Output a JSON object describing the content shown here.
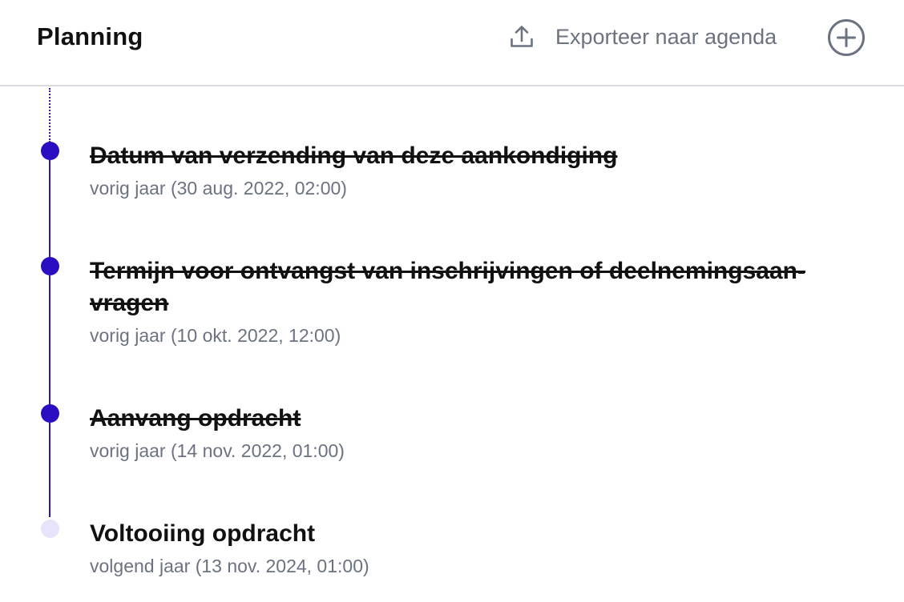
{
  "header": {
    "title": "Planning",
    "export_label": "Exporteer naar agenda",
    "export_icon": "upload-icon",
    "add_icon": "plus-circle-icon"
  },
  "colors": {
    "accent": "#2a0ec2",
    "future_dot": "#e6e3fb",
    "muted_text": "#6b7280",
    "divider": "#d9dbe0"
  },
  "events": [
    {
      "title": "Datum van verzending van deze aankondiging",
      "date": "vorig jaar (30 aug. 2022, 02:00)",
      "status": "past"
    },
    {
      "title_line1": "Termijn voor ontvangst van inschrijvingen of deelnemingsaan-",
      "title_line2": "vragen",
      "date": "vorig jaar (10 okt. 2022, 12:00)",
      "status": "past"
    },
    {
      "title": "Aanvang opdracht",
      "date": "vorig jaar (14 nov. 2022, 01:00)",
      "status": "past"
    },
    {
      "title": "Voltooiing opdracht",
      "date": "volgend jaar (13 nov. 2024, 01:00)",
      "status": "future"
    }
  ]
}
